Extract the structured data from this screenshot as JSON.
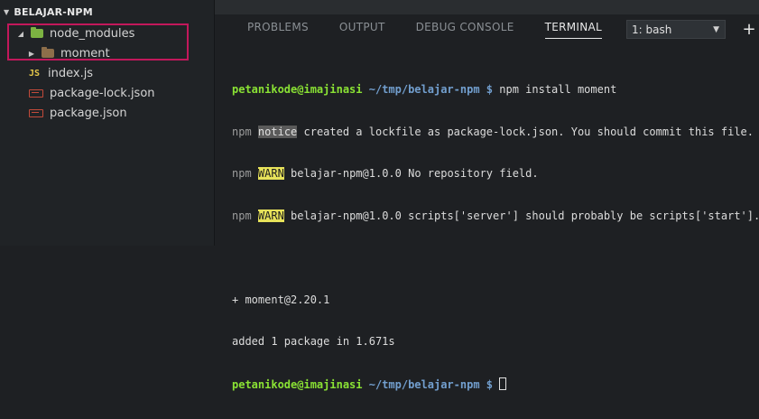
{
  "explorer": {
    "project_title": "BELAJAR-NPM",
    "items": [
      {
        "label": "node_modules",
        "icon": "folder-green-icon"
      },
      {
        "label": "moment",
        "icon": "folder-icon"
      },
      {
        "label": "index.js",
        "icon": "js-file-icon",
        "icon_text": "JS"
      },
      {
        "label": "package-lock.json",
        "icon": "json-file-icon"
      },
      {
        "label": "package.json",
        "icon": "json-file-icon"
      }
    ]
  },
  "panel": {
    "tabs": [
      {
        "label": "PROBLEMS"
      },
      {
        "label": "OUTPUT"
      },
      {
        "label": "DEBUG CONSOLE"
      },
      {
        "label": "TERMINAL",
        "active": true
      }
    ],
    "terminal_select": "1: bash",
    "add_terminal": "+"
  },
  "terminal": {
    "prompt_user": "petanikode@imajinasi",
    "prompt_path": "~/tmp/belajar-npm $",
    "command": "npm install moment",
    "npm": "npm",
    "notice_tag": "notice",
    "notice_text": " created a lockfile as package-lock.json. You should commit this file.",
    "warn_tag": "WARN",
    "warn1_text": " belajar-npm@1.0.0 No repository field.",
    "warn2_text": " belajar-npm@1.0.0 scripts['server'] should probably be scripts['start'].",
    "result_line": "+ moment@2.20.1",
    "added_line": "added 1 package in 1.671s"
  },
  "colors": {
    "highlight_border": "#c2185b",
    "prompt_user": "#8ae234",
    "prompt_path": "#729fcf",
    "warn_bg": "#e7e25a",
    "node_modules_folder": "#7cb342",
    "folder": "#8d6e4a"
  }
}
